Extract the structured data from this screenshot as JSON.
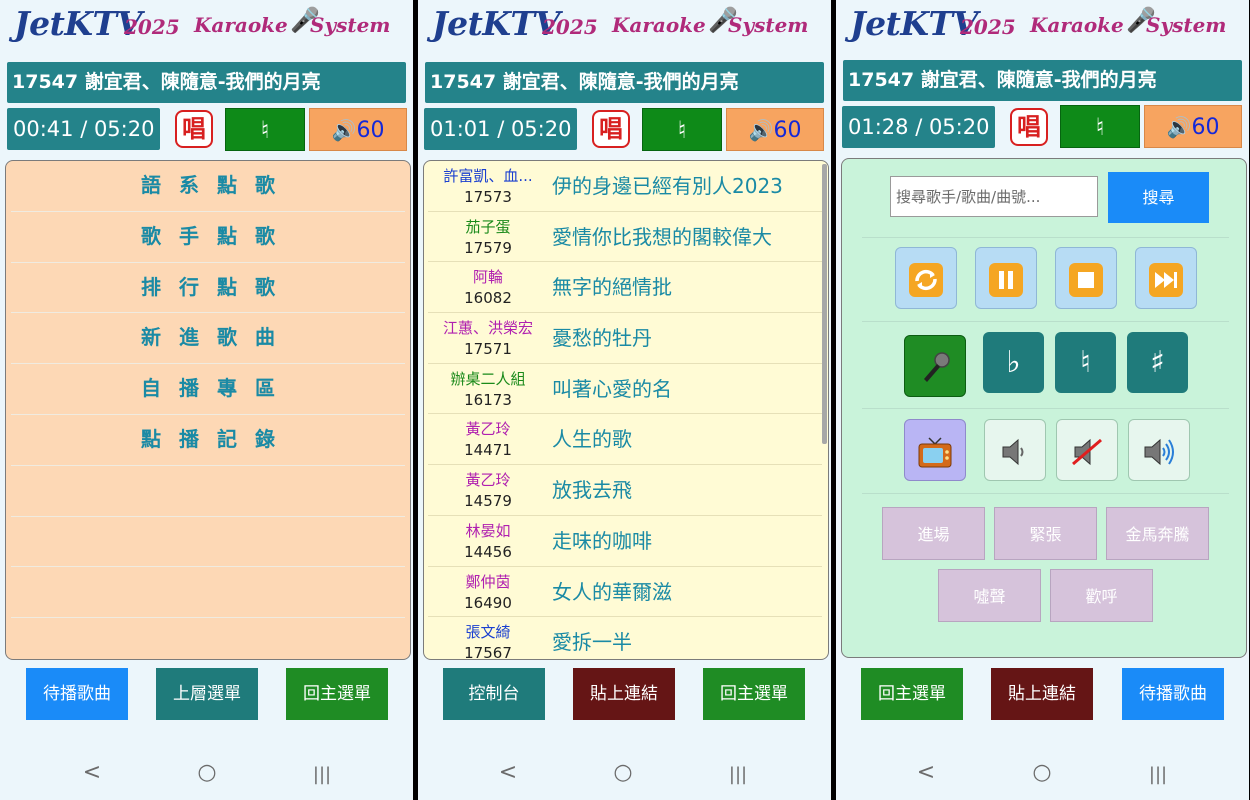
{
  "logo": {
    "main": "JetKTV",
    "year": "2025",
    "karaoke": "Karaoke",
    "system": "System"
  },
  "colors": {
    "teal": "#24838a",
    "key_green": "#0e8a18",
    "volume_orange": "#f7a460",
    "menu_bg": "#fdd8b5",
    "list_bg": "#fffbd5",
    "control_bg": "#c9f3da",
    "sfx_purple": "#d6c3db",
    "blue_button": "#1a8bf8"
  },
  "now_playing": "17547 謝宜君、陳隨意-我們的月亮",
  "sing_label": "唱",
  "key_label": "♮",
  "volume_value": "60",
  "panel1": {
    "time": "00:41 / 05:20",
    "menu": [
      "語系點歌",
      "歌手點歌",
      "排行點歌",
      "新進歌曲",
      "自播專區",
      "點播記錄"
    ],
    "buttons": [
      "待播歌曲",
      "上層選單",
      "回主選單"
    ]
  },
  "panel2": {
    "time": "01:01 / 05:20",
    "songs": [
      {
        "singer": "許富凱、血...",
        "num": "17573",
        "title": "伊的身邊已經有別人2023",
        "color": "#1a3fd0"
      },
      {
        "singer": "茄子蛋",
        "num": "17579",
        "title": "愛情你比我想的閣較偉大",
        "color": "#1a8a1a"
      },
      {
        "singer": "阿輪",
        "num": "16082",
        "title": "無字的絕情批",
        "color": "#b020b0"
      },
      {
        "singer": "江蕙、洪榮宏",
        "num": "17571",
        "title": "憂愁的牡丹",
        "color": "#b020b0"
      },
      {
        "singer": "辦桌二人組",
        "num": "16173",
        "title": "叫著心愛的名",
        "color": "#1a8a1a"
      },
      {
        "singer": "黃乙玲",
        "num": "14471",
        "title": "人生的歌",
        "color": "#b020b0"
      },
      {
        "singer": "黃乙玲",
        "num": "14579",
        "title": "放我去飛",
        "color": "#b020b0"
      },
      {
        "singer": "林晏如",
        "num": "14456",
        "title": "走味的咖啡",
        "color": "#b020b0"
      },
      {
        "singer": "鄭仲茵",
        "num": "16490",
        "title": "女人的華爾滋",
        "color": "#b020b0"
      },
      {
        "singer": "張文綺",
        "num": "17567",
        "title": "愛拆一半",
        "color": "#1a3fd0"
      }
    ],
    "buttons": [
      "控制台",
      "貼上連結",
      "回主選單"
    ]
  },
  "panel3": {
    "time": "01:28 / 05:20",
    "search_placeholder": "搜尋歌手/歌曲/曲號...",
    "search_button": "搜尋",
    "key_flat": "♭",
    "key_natural": "♮",
    "key_sharp": "♯",
    "sfx": [
      "進場",
      "緊張",
      "金馬奔騰",
      "噓聲",
      "歡呼"
    ],
    "buttons": [
      "回主選單",
      "貼上連結",
      "待播歌曲"
    ]
  },
  "icons": [
    "repeat-icon",
    "pause-icon",
    "stop-icon",
    "skip-icon",
    "microphone-icon",
    "tv-icon",
    "speaker-icon",
    "mute-icon",
    "volume-up-icon",
    "back-icon",
    "home-icon",
    "recents-icon"
  ]
}
